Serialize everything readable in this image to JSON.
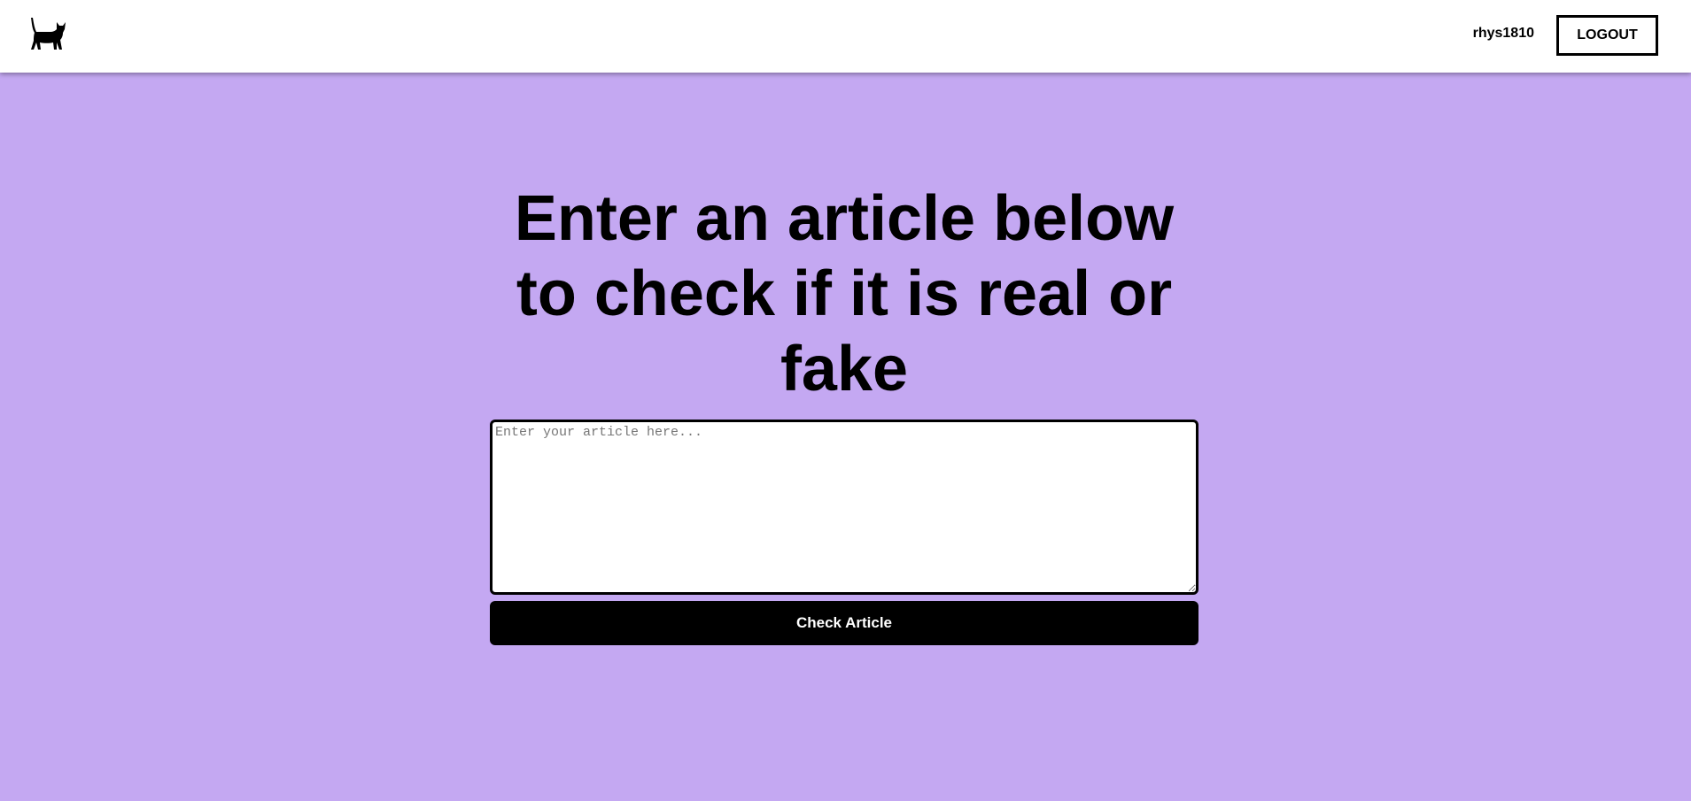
{
  "header": {
    "logo_icon": "cat-icon",
    "username": "rhys1810",
    "logout_label": "LOGOUT"
  },
  "main": {
    "heading": "Enter an article below to check if it is real or fake",
    "article_input": {
      "placeholder": "Enter your article here...",
      "value": ""
    },
    "check_button_label": "Check Article"
  },
  "colors": {
    "background": "#c4a8f2",
    "navbar": "#ffffff",
    "button": "#000000"
  }
}
